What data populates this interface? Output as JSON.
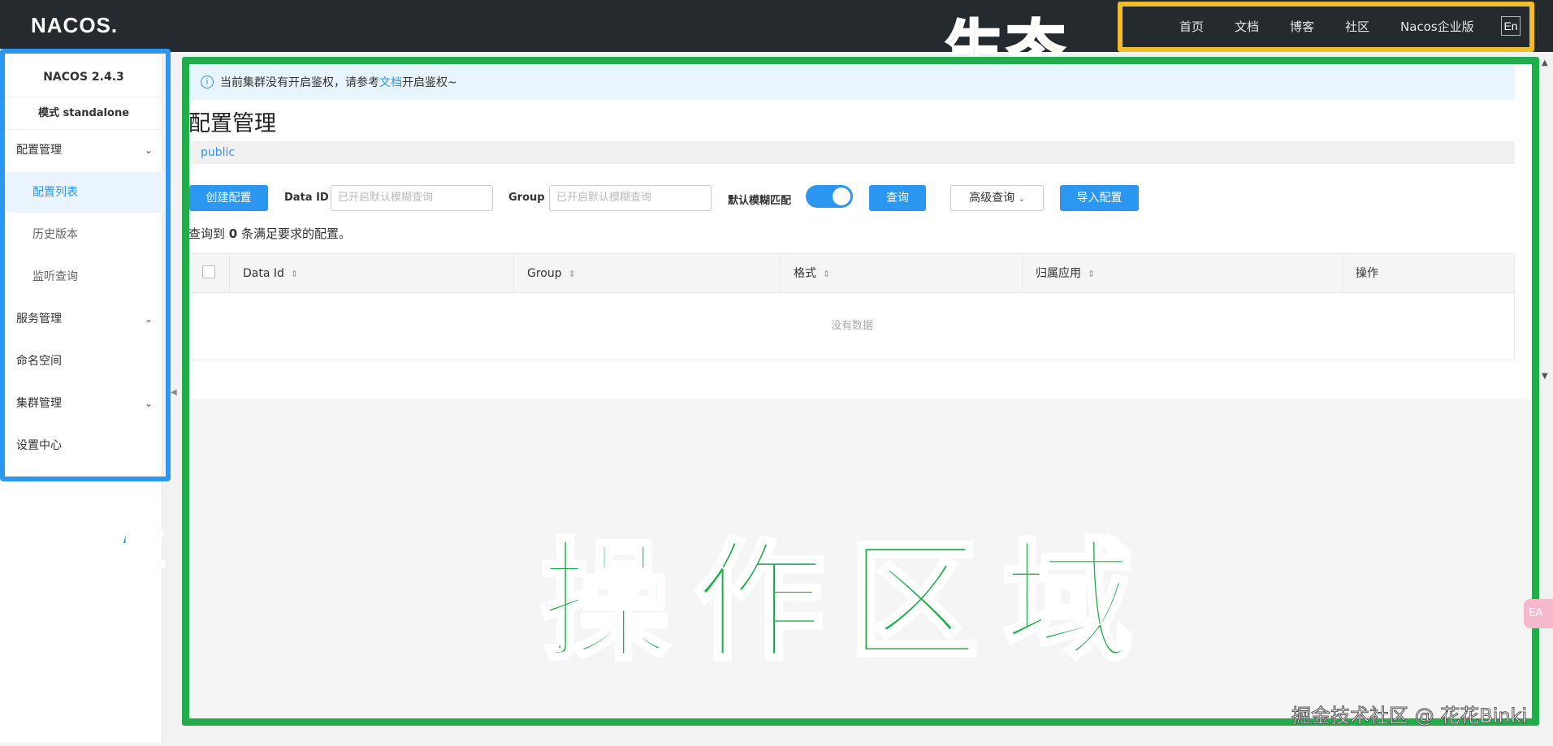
{
  "header": {
    "logo": "NACOS.",
    "nav": [
      "首页",
      "文档",
      "博客",
      "社区",
      "Nacos企业版"
    ],
    "lang": "En",
    "eco_label": "生态"
  },
  "sidebar": {
    "version": "NACOS 2.4.3",
    "mode": "模式 standalone",
    "items": [
      {
        "label": "配置管理"
      },
      {
        "label": "配置列表"
      },
      {
        "label": "历史版本"
      },
      {
        "label": "监听查询"
      },
      {
        "label": "服务管理"
      },
      {
        "label": "命名空间"
      },
      {
        "label": "集群管理"
      },
      {
        "label": "设置中心"
      }
    ],
    "annotation": "菜单栏"
  },
  "main": {
    "notice_prefix": "当前集群没有开启鉴权，请参考",
    "notice_link": "文档",
    "notice_suffix": "开启鉴权~",
    "title": "配置管理",
    "namespace": "public",
    "create_button": "创建配置",
    "data_id_label": "Data ID",
    "data_id_placeholder": "已开启默认模糊查询",
    "group_label": "Group",
    "group_placeholder": "已开启默认模糊查询",
    "fuzzy_label": "默认模糊匹配",
    "query_button": "查询",
    "advanced_button": "高级查询",
    "import_button": "导入配置",
    "result_prefix": "查询到",
    "result_count": "0",
    "result_suffix": "条满足要求的配置。",
    "table": {
      "columns": [
        "Data Id",
        "Group",
        "格式",
        "归属应用",
        "操作"
      ],
      "empty": "没有数据"
    },
    "annotation": "操作区域"
  },
  "watermark": "掘金技术社区 @ 花花Binki",
  "side_tab": "EA"
}
